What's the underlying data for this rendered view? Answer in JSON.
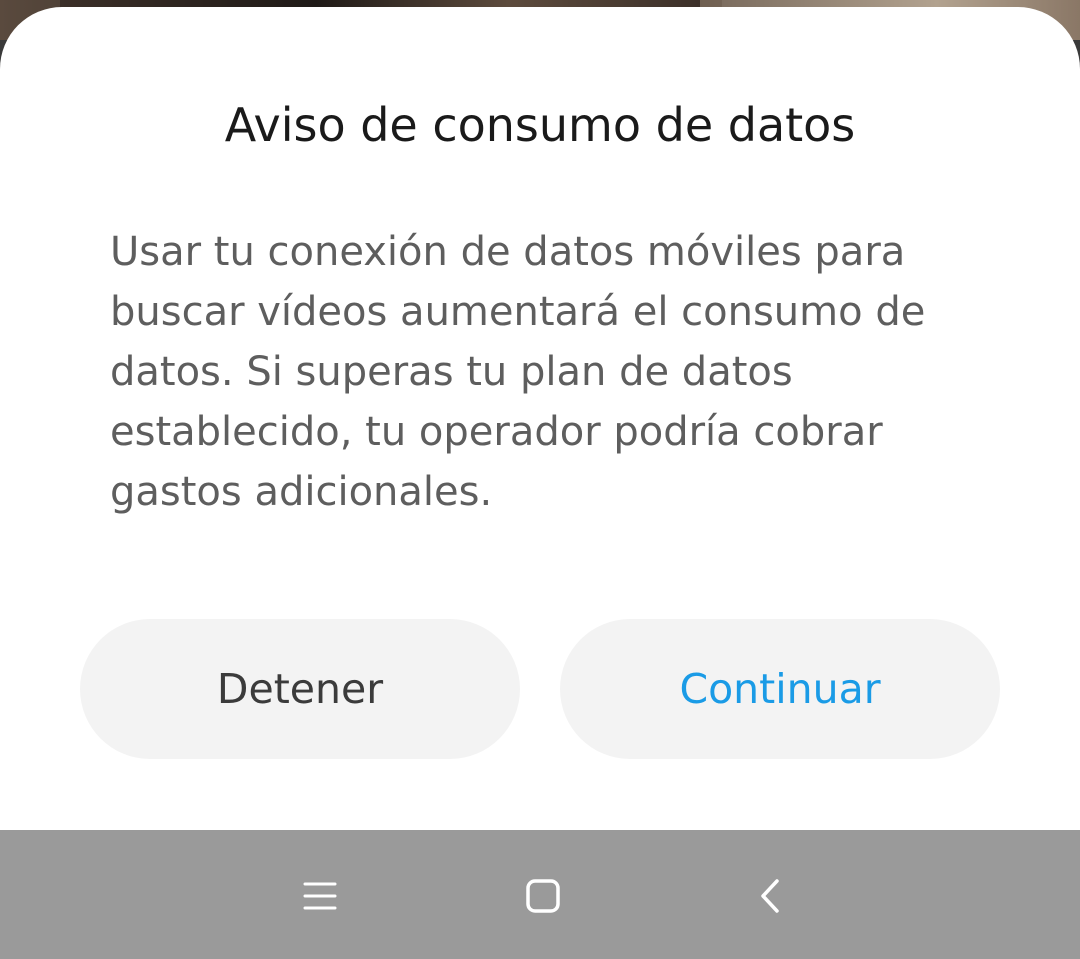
{
  "dialog": {
    "title": "Aviso de consumo de datos",
    "message": "Usar tu conexión de datos móviles para buscar vídeos aumentará el consumo de datos. Si superas tu plan de datos establecido, tu operador podría cobrar gastos adicionales.",
    "stop_label": "Detener",
    "continue_label": "Continuar"
  },
  "colors": {
    "accent": "#1a9be6",
    "button_bg": "#f3f3f3",
    "navbar_bg": "#9a9a9a"
  },
  "navbar": {
    "icons": [
      "menu-icon",
      "home-icon",
      "back-icon"
    ]
  }
}
